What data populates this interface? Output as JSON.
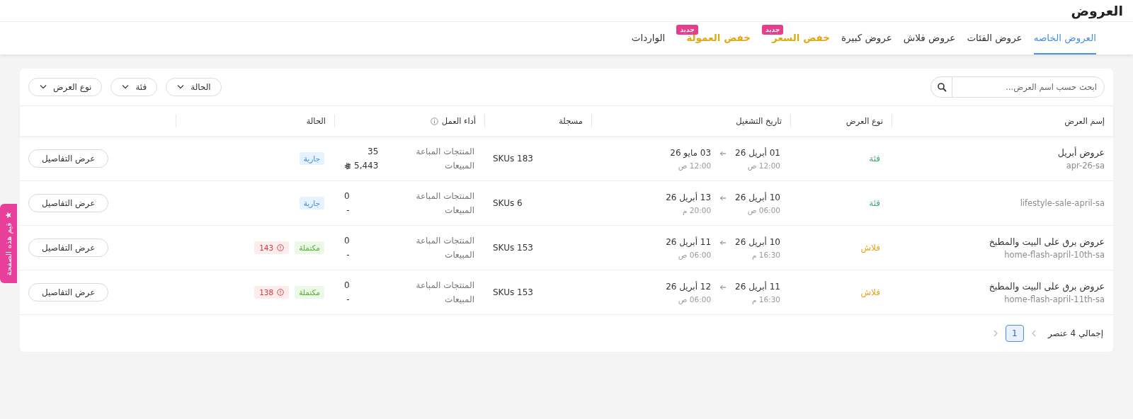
{
  "page_title": "العروض",
  "tabs": [
    {
      "label": "العروض الخاصه",
      "selected": true,
      "highlight": false
    },
    {
      "label": "عروض الفئات",
      "selected": false,
      "highlight": false
    },
    {
      "label": "عروض فلاش",
      "selected": false,
      "highlight": false
    },
    {
      "label": "عروض كبيرة",
      "selected": false,
      "highlight": false
    },
    {
      "label": "خفض السعر",
      "selected": false,
      "highlight": true,
      "badge": "جديد"
    },
    {
      "label": "خفض العمولة",
      "selected": false,
      "highlight": true,
      "badge": "جديد"
    },
    {
      "label": "الواردات",
      "selected": false,
      "highlight": false
    }
  ],
  "search": {
    "placeholder": "ابحث حسب اسم العرض..."
  },
  "filters": [
    "الحالة",
    "فئة",
    "نوع العرض"
  ],
  "table": {
    "columns": [
      {
        "label": "إسم العرض",
        "info": false
      },
      {
        "label": "نوع العرض",
        "info": false
      },
      {
        "label": "تاريخ التشغيل",
        "info": false
      },
      {
        "label": "مسجلة",
        "info": false
      },
      {
        "label": "أداء العمل",
        "info": true
      },
      {
        "label": "الحالة",
        "info": false
      }
    ],
    "rows": [
      {
        "name": "عروض أبريل",
        "slug": "apr-26-sa",
        "type": {
          "label": "فئة",
          "kind": "category"
        },
        "start_date": "01 أبريل 26",
        "start_time": "12:00 ص",
        "end_date": "03 مايو 26",
        "end_time": "12:00 ص",
        "registered": "SKUs 183",
        "sold_label": "المنتجات المباعة",
        "sold": "35",
        "sales_label": "المبيعات",
        "sales": "5,443",
        "sales_currency": true,
        "status": {
          "label": "جارية",
          "kind": "running"
        },
        "action": "عرض التفاصيل"
      },
      {
        "slug": "lifestyle-sale-april-sa",
        "type": {
          "label": "فئة",
          "kind": "category"
        },
        "start_date": "10 أبريل 26",
        "start_time": "06:00 ص",
        "end_date": "13 أبريل 26",
        "end_time": "20:00 م",
        "registered": "SKUs 6",
        "sold_label": "المنتجات المباعة",
        "sold": "0",
        "sales_label": "المبيعات",
        "sales": "-",
        "sales_currency": false,
        "status": {
          "label": "جارية",
          "kind": "running"
        },
        "action": "عرض التفاصيل"
      },
      {
        "name": "عروض برق على البيت والمطبخ",
        "slug": "home-flash-april-10th-sa",
        "type": {
          "label": "فلاش",
          "kind": "flash"
        },
        "start_date": "10 أبريل 26",
        "start_time": "16:30 م",
        "end_date": "11 أبريل 26",
        "end_time": "06:00 ص",
        "registered": "SKUs 153",
        "sold_label": "المنتجات المباعة",
        "sold": "0",
        "sales_label": "المبيعات",
        "sales": "-",
        "sales_currency": false,
        "status": {
          "label": "مكتملة",
          "kind": "completed"
        },
        "errors": "143",
        "action": "عرض التفاصيل"
      },
      {
        "name": "عروض برق على البيت والمطبخ",
        "slug": "home-flash-april-11th-sa",
        "type": {
          "label": "فلاش",
          "kind": "flash"
        },
        "start_date": "11 أبريل 26",
        "start_time": "16:30 م",
        "end_date": "12 أبريل 26",
        "end_time": "06:00 ص",
        "registered": "SKUs 153",
        "sold_label": "المنتجات المباعة",
        "sold": "0",
        "sales_label": "المبيعات",
        "sales": "-",
        "sales_currency": false,
        "status": {
          "label": "مكتملة",
          "kind": "completed"
        },
        "errors": "138",
        "action": "عرض التفاصيل"
      }
    ]
  },
  "pagination": {
    "total": "إجمالي 4 عنصر",
    "pages": [
      {
        "label": "1",
        "selected": true
      }
    ]
  },
  "feedback_tab": {
    "label": "قيم هذه الصفحة"
  }
}
